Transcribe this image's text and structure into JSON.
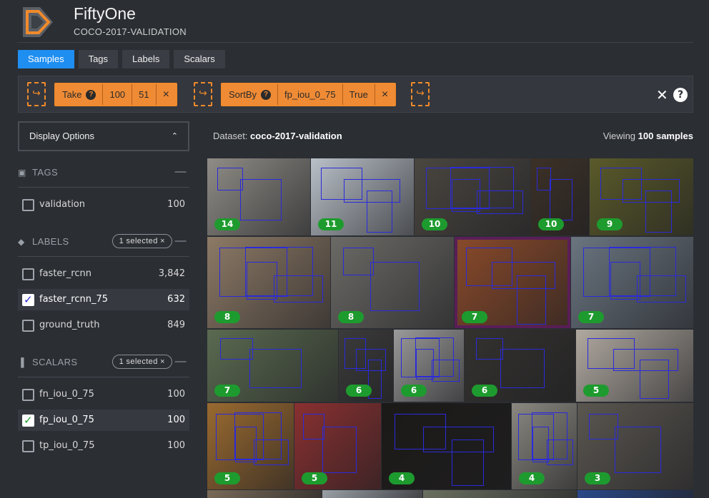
{
  "header": {
    "app_name": "FiftyOne",
    "dataset_name": "COCO-2017-VALIDATION"
  },
  "tabs": [
    {
      "label": "Samples",
      "active": true
    },
    {
      "label": "Tags",
      "active": false
    },
    {
      "label": "Labels",
      "active": false
    },
    {
      "label": "Scalars",
      "active": false
    }
  ],
  "view_bar": {
    "add_icon": "↪",
    "stages": [
      {
        "name": "Take",
        "params": [
          "100",
          "51"
        ]
      },
      {
        "name": "SortBy",
        "params": [
          "fp_iou_0_75",
          "True"
        ]
      }
    ],
    "remove_icon": "×",
    "help_icon": "?",
    "clear_icon": "✕"
  },
  "sidebar": {
    "display_options_label": "Display Options",
    "tags": {
      "title": "TAGS",
      "items": [
        {
          "label": "validation",
          "count": "100",
          "checked": false
        }
      ]
    },
    "labels": {
      "title": "LABELS",
      "badge": "1 selected ×",
      "items": [
        {
          "label": "faster_rcnn",
          "count": "3,842",
          "checked": false
        },
        {
          "label": "faster_rcnn_75",
          "count": "632",
          "checked": true,
          "check_color": "#2b2bd6"
        },
        {
          "label": "ground_truth",
          "count": "849",
          "checked": false
        }
      ]
    },
    "scalars": {
      "title": "SCALARS",
      "badge": "1 selected ×",
      "items": [
        {
          "label": "fn_iou_0_75",
          "count": "100",
          "checked": false
        },
        {
          "label": "fp_iou_0_75",
          "count": "100",
          "checked": true,
          "check_color": "#1e9b2e"
        },
        {
          "label": "tp_iou_0_75",
          "count": "100",
          "checked": false
        }
      ]
    }
  },
  "main": {
    "dataset_prefix": "Dataset:",
    "dataset_value": "coco-2017-validation",
    "viewing_prefix": "Viewing",
    "viewing_value": "100 samples"
  },
  "samples": [
    {
      "label": "14",
      "color": "#8f8c86"
    },
    {
      "label": "11",
      "color": "#b9c0c8"
    },
    {
      "label": "10",
      "color": "#4a4640"
    },
    {
      "label": "10",
      "color": "#3c3127"
    },
    {
      "label": "9",
      "color": "#5a5a2a"
    },
    {
      "label": "8",
      "color": "#8d7a66"
    },
    {
      "label": "8",
      "color": "#6b6a66"
    },
    {
      "label": "7",
      "color": "#8a4a2a"
    },
    {
      "label": "7",
      "color": "#6a7580"
    },
    {
      "label": "7",
      "color": "#5a6a50"
    },
    {
      "label": "6",
      "color": "#3b3b3b"
    },
    {
      "label": "6",
      "color": "#9a9a9a"
    },
    {
      "label": "6",
      "color": "#34322f"
    },
    {
      "label": "5",
      "color": "#b0a9a0"
    },
    {
      "label": "5",
      "color": "#9a6a30"
    },
    {
      "label": "5",
      "color": "#8a3030"
    },
    {
      "label": "4",
      "color": "#1c1a18"
    },
    {
      "label": "4",
      "color": "#8a8880"
    },
    {
      "label": "3",
      "color": "#5a5650"
    },
    {
      "label": "",
      "color": "#7a6a58"
    },
    {
      "label": "",
      "color": "#9aa0a6"
    },
    {
      "label": "",
      "color": "#6a7060"
    },
    {
      "label": "",
      "color": "#2a4a8a"
    }
  ]
}
